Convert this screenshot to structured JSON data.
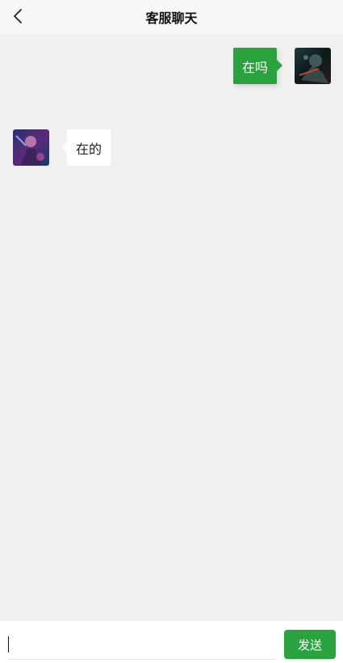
{
  "header": {
    "title": "客服聊天",
    "back_icon": "chevron-left-icon"
  },
  "messages": [
    {
      "direction": "outgoing",
      "text": "在吗"
    },
    {
      "direction": "incoming",
      "text": "在的"
    }
  ],
  "composer": {
    "value": "",
    "send_label": "发送"
  },
  "colors": {
    "accent": "#2aa33e",
    "background": "#f0f0f0",
    "header_bg": "#f7f7f7"
  }
}
